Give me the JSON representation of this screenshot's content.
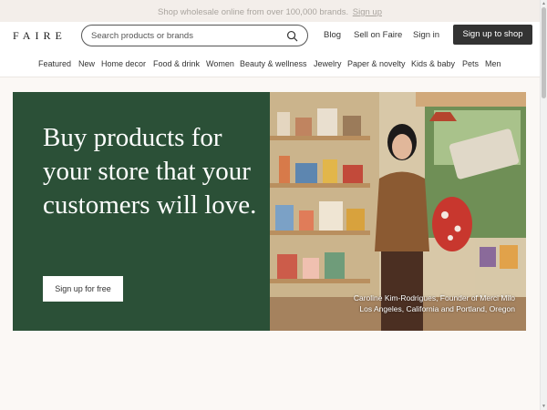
{
  "banner": {
    "text": "Shop wholesale online from over 100,000 brands.",
    "link": "Sign up"
  },
  "header": {
    "logo": "FAIRE",
    "search_placeholder": "Search products or brands",
    "links": {
      "blog": "Blog",
      "sell": "Sell on Faire",
      "signin": "Sign in"
    },
    "signup": "Sign up to shop"
  },
  "categories": [
    "Featured",
    "New",
    "Home decor",
    "Food & drink",
    "Women",
    "Beauty & wellness",
    "Jewelry",
    "Paper & novelty",
    "Kids & baby",
    "Pets",
    "Men"
  ],
  "hero": {
    "headline": "Buy products for your store that your customers will love.",
    "cta": "Sign up for free",
    "caption_line1": "Caroline Kim-Rodrigues, Founder of Merci Milo",
    "caption_line2": "Los Angeles, California and Portland, Oregon"
  },
  "colors": {
    "hero_green": "#2b5037",
    "dark_button": "#333333",
    "page_bg": "#fbf8f5"
  }
}
